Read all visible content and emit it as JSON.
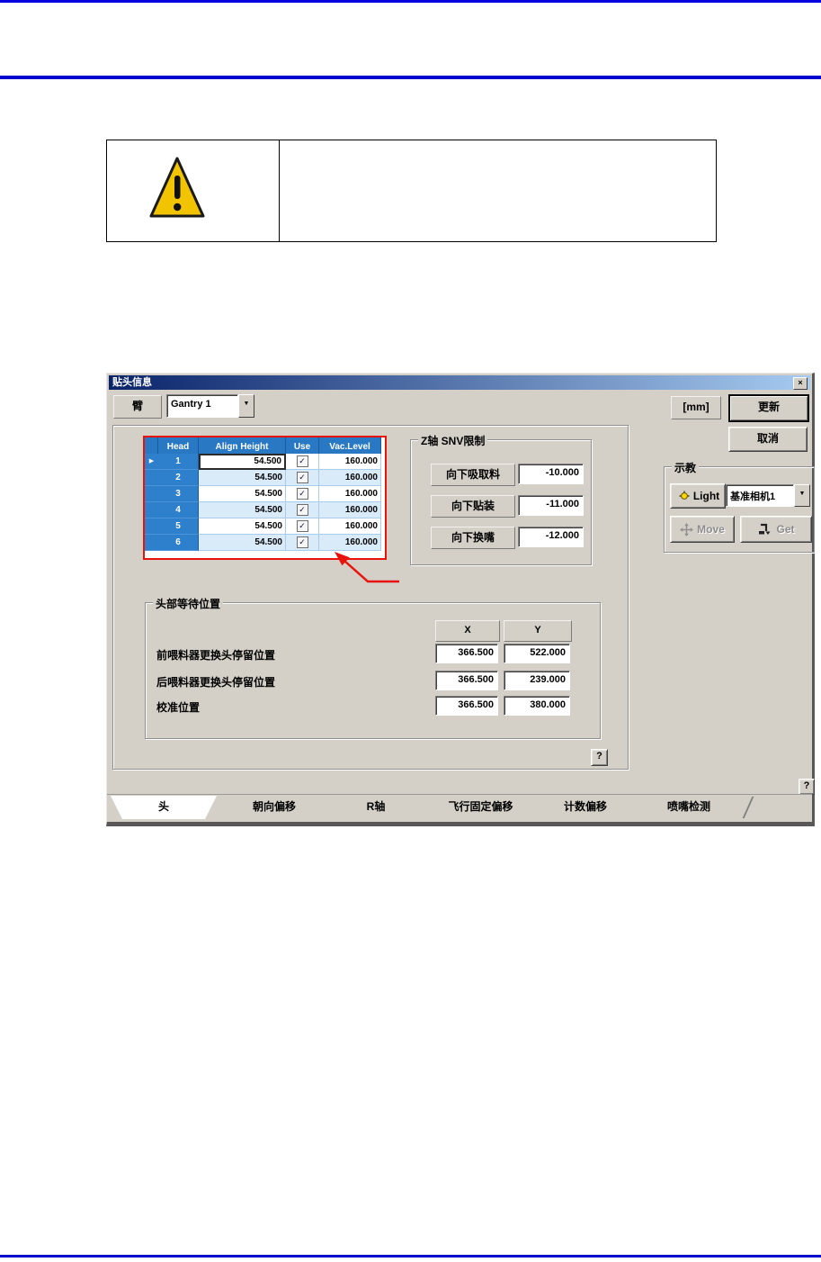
{
  "icons": {
    "close": "×",
    "dropdown": "▼",
    "row_selector": "▶",
    "check": "✓"
  },
  "colors": {
    "page_rule_blue": "#0000cc",
    "dialog_background": "#d4d0c8",
    "titlebar_gradient_left": "#0a246a",
    "titlebar_gradient_right": "#a6caf0",
    "grid_header_blue": "#2878c4",
    "grid_alt_row_blue": "#d9eaf9",
    "annotation_red": "#e8140c",
    "warning_yellow": "#f2c400"
  },
  "dialog": {
    "title": "贴头信息",
    "arm_label": "臂",
    "arm_select_value": "Gantry 1",
    "units_label": "[mm]",
    "update_button": "更新",
    "cancel_button": "取消",
    "help_button": "?",
    "table": {
      "columns": [
        "Head",
        "Align Height",
        "Use",
        "Vac.Level"
      ],
      "rows": [
        {
          "head": "1",
          "align_height": "54.500",
          "use": true,
          "vac_level": "160.000"
        },
        {
          "head": "2",
          "align_height": "54.500",
          "use": true,
          "vac_level": "160.000"
        },
        {
          "head": "3",
          "align_height": "54.500",
          "use": true,
          "vac_level": "160.000"
        },
        {
          "head": "4",
          "align_height": "54.500",
          "use": true,
          "vac_level": "160.000"
        },
        {
          "head": "5",
          "align_height": "54.500",
          "use": true,
          "vac_level": "160.000"
        },
        {
          "head": "6",
          "align_height": "54.500",
          "use": true,
          "vac_level": "160.000"
        }
      ]
    },
    "z_snv_group": {
      "title": "Z轴 SNV限制",
      "rows": [
        {
          "label": "向下吸取料",
          "value": "-10.000"
        },
        {
          "label": "向下贴装",
          "value": "-11.000"
        },
        {
          "label": "向下换嘴",
          "value": "-12.000"
        }
      ]
    },
    "teach_group": {
      "title": "示教",
      "light_button": "Light",
      "camera_select_value": "基准相机1",
      "move_button": "Move",
      "get_button": "Get"
    },
    "wait_group": {
      "title": "头部等待位置",
      "col_x": "X",
      "col_y": "Y",
      "rows": [
        {
          "label": "前喂料器更换头停留位置",
          "x": "366.500",
          "y": "522.000"
        },
        {
          "label": "后喂料器更换头停留位置",
          "x": "366.500",
          "y": "239.000"
        },
        {
          "label": "校准位置",
          "x": "366.500",
          "y": "380.000"
        }
      ]
    },
    "tabs": [
      {
        "label": "头"
      },
      {
        "label": "朝向偏移"
      },
      {
        "label": "R轴"
      },
      {
        "label": "飞行固定偏移"
      },
      {
        "label": "计数偏移"
      },
      {
        "label": "喷嘴检测"
      }
    ]
  }
}
